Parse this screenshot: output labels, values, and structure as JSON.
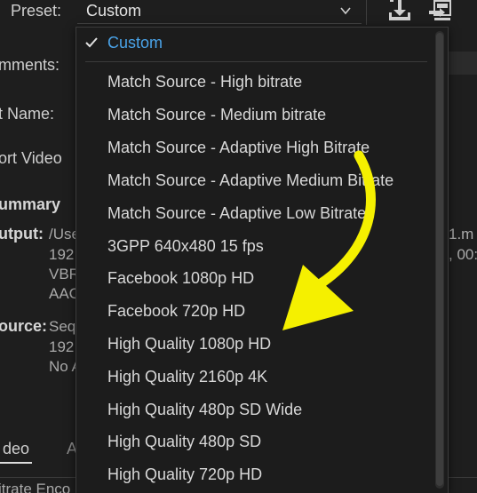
{
  "toolbar": {
    "preset_label": "Preset:",
    "preset_value": "Custom",
    "icons": [
      "save-preset-icon",
      "import-preset-icon"
    ]
  },
  "background": {
    "comments_label": "mments:",
    "name_label": "t Name:",
    "export_video_label": "ort Video",
    "summary_label": "ummary",
    "output_label": "utput:",
    "output_lines": [
      "/Use",
      "192",
      "VBR",
      "AAC"
    ],
    "source_label": "ource:",
    "source_lines": [
      "Seq",
      "192",
      "No A"
    ],
    "right_fragments": [
      "1.m",
      ", 00:"
    ],
    "tab_video": "deo",
    "tab_audio": "A",
    "bitrate_fragment": "itrate Enco"
  },
  "dropdown": {
    "items": [
      {
        "label": "Custom",
        "selected": true
      },
      {
        "label": "Match Source - High bitrate",
        "selected": false
      },
      {
        "label": "Match Source - Medium bitrate",
        "selected": false
      },
      {
        "label": "Match Source - Adaptive High Bitrate",
        "selected": false
      },
      {
        "label": "Match Source - Adaptive Medium Bitrate",
        "selected": false
      },
      {
        "label": "Match Source - Adaptive Low Bitrate",
        "selected": false
      },
      {
        "label": "3GPP 640x480 15 fps",
        "selected": false
      },
      {
        "label": "Facebook 1080p HD",
        "selected": false
      },
      {
        "label": "Facebook 720p HD",
        "selected": false
      },
      {
        "label": "High Quality 1080p HD",
        "selected": false
      },
      {
        "label": "High Quality 2160p 4K",
        "selected": false
      },
      {
        "label": "High Quality 480p SD Wide",
        "selected": false
      },
      {
        "label": "High Quality 480p SD",
        "selected": false
      },
      {
        "label": "High Quality 720p HD",
        "selected": false
      }
    ]
  },
  "colors": {
    "selected_text": "#4aa3e8",
    "annotation_arrow": "#f5f000"
  }
}
